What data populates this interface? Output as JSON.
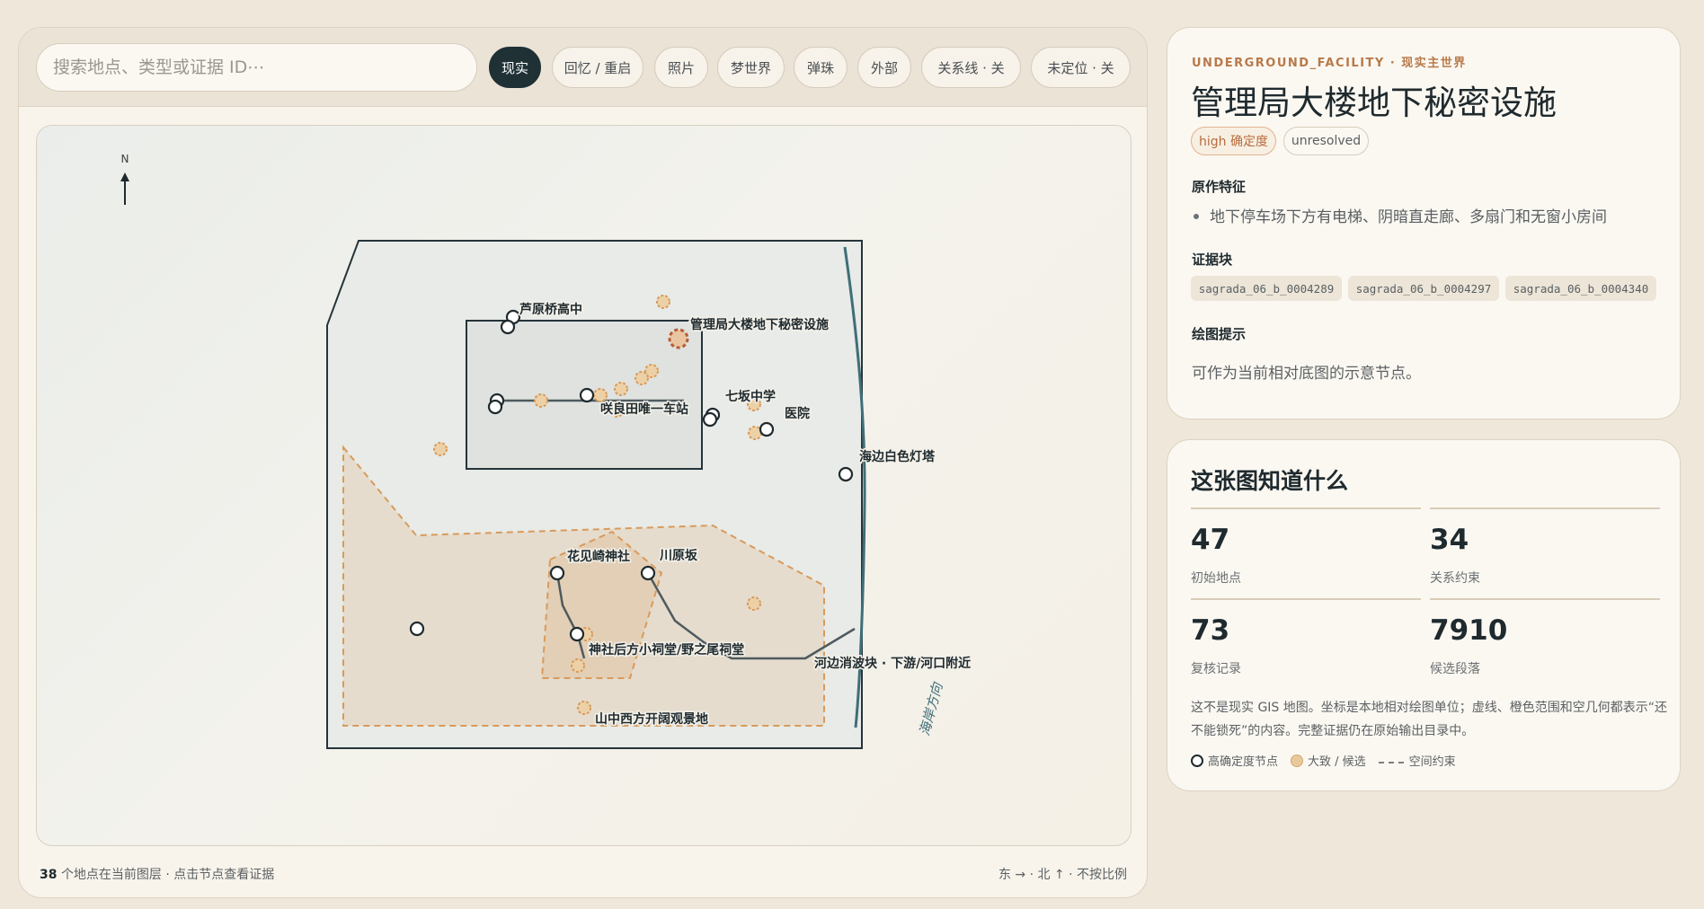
{
  "search": {
    "placeholder": "搜索地点、类型或证据 ID⋯"
  },
  "filters": [
    {
      "label": "现实",
      "active": true
    },
    {
      "label": "回忆 / 重启",
      "active": false
    },
    {
      "label": "照片",
      "active": false
    },
    {
      "label": "梦世界",
      "active": false
    },
    {
      "label": "弹珠",
      "active": false
    },
    {
      "label": "外部",
      "active": false
    },
    {
      "label": "关系线 · 关",
      "active": false
    },
    {
      "label": "未定位 · 关",
      "active": false
    }
  ],
  "map": {
    "north_label": "N",
    "direction_label": "海岸方向",
    "places": [
      {
        "label": "芦原桥高中"
      },
      {
        "label": "管理局大楼地下秘密设施"
      },
      {
        "label": "咲良田唯一车站"
      },
      {
        "label": "七坂中学"
      },
      {
        "label": "医院"
      },
      {
        "label": "海边白色灯塔"
      },
      {
        "label": "花见崎神社"
      },
      {
        "label": "川原坂"
      },
      {
        "label": "神社后方小祠堂/野之尾祠堂"
      },
      {
        "label": "河边消波块 · 下游/河口附近"
      },
      {
        "label": "山中西方开阔观景地"
      }
    ]
  },
  "footer": {
    "count": "38",
    "count_text": "个地点在当前图层 · 点击节点查看证据",
    "orientation": "东 → · 北 ↑ · 不按比例"
  },
  "detail": {
    "eyebrow": "UNDERGROUND_FACILITY · 现实主世界",
    "title": "管理局大楼地下秘密设施",
    "tags": [
      {
        "label": "high 确定度",
        "style": "warn"
      },
      {
        "label": "unresolved",
        "style": "plain"
      }
    ],
    "features_heading": "原作特征",
    "features": [
      "地下停车场下方有电梯、阴暗直走廊、多扇门和无窗小房间"
    ],
    "evidence_heading": "证据块",
    "evidence": [
      "sagrada_06_b_0004289",
      "sagrada_06_b_0004297",
      "sagrada_06_b_0004340"
    ],
    "hint_heading": "绘图提示",
    "hint": "可作为当前相对底图的示意节点。"
  },
  "stats": {
    "title": "这张图知道什么",
    "items": [
      {
        "value": "47",
        "label": "初始地点"
      },
      {
        "value": "34",
        "label": "关系约束"
      },
      {
        "value": "73",
        "label": "复核记录"
      },
      {
        "value": "7910",
        "label": "候选段落"
      }
    ],
    "note": "这不是现实 GIS 地图。坐标是本地相对绘图单位；虚线、橙色范围和空几何都表示“还不能锁死”的内容。完整证据仍在原始输出目录中。",
    "legend": [
      {
        "icon": "circle",
        "label": "高确定度节点"
      },
      {
        "icon": "fill",
        "label": "大致 / 候选"
      },
      {
        "icon": "dash",
        "label": "空间约束"
      }
    ]
  },
  "colors": {
    "accent_dark": "#1f3135",
    "candidate_orange": "#d99a5b",
    "river_teal": "#3f6e78",
    "warn_text": "#b76d3e"
  }
}
